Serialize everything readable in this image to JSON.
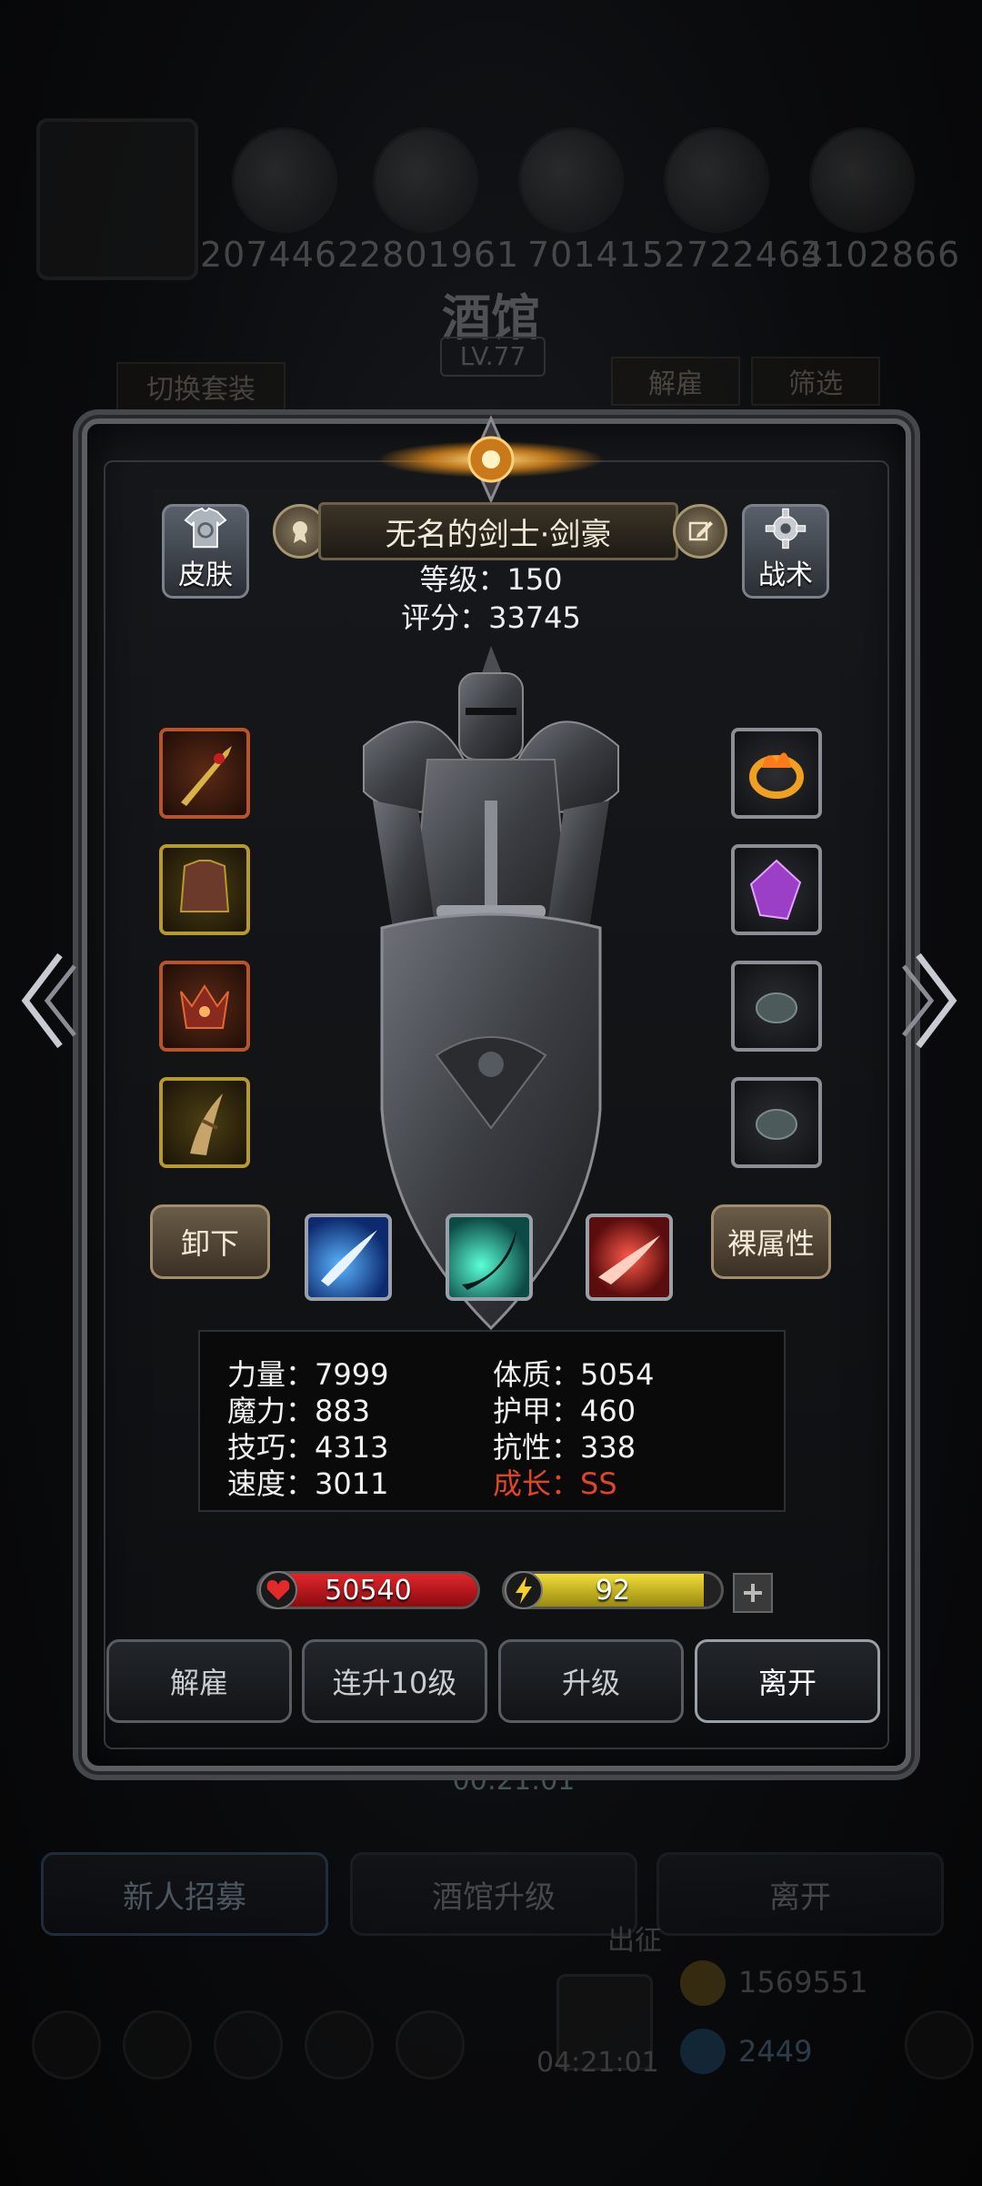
{
  "background": {
    "resources": [
      "2074462",
      "2801961",
      "701415",
      "2722464",
      "3102866"
    ],
    "tavern_title": "酒馆",
    "tavern_level": "LV.77",
    "switch_outfit": "切换套装",
    "dismiss": "解雇",
    "filter": "筛选",
    "timer_mid": "00:21:01",
    "bottom_buttons": [
      "新人招募",
      "酒馆升级",
      "离开"
    ],
    "expedition": "出征",
    "gold": "1569551",
    "gems": "2449",
    "timer_bottom": "04:21:01"
  },
  "hero": {
    "name": "无名的剑士·剑豪",
    "level_text": "等级：150",
    "score_text": "评分：33745",
    "skin_label": "皮肤",
    "tactics_label": "战术",
    "unequip_label": "卸下",
    "base_attr_label": "裸属性"
  },
  "stats": {
    "strength": "力量：7999",
    "constitution": "体质：5054",
    "magic": "魔力：883",
    "armor": "护甲：460",
    "skill": "技巧：4313",
    "resistance": "抗性：338",
    "speed": "速度：3011",
    "growth": "成长：SS"
  },
  "bars": {
    "hp": "50540",
    "energy": "92",
    "energy_fraction": 0.92
  },
  "actions": [
    "解雇",
    "连升10级",
    "升级",
    "离开"
  ],
  "colors": {
    "hp": "#c8161c",
    "energy": "#d8c21a",
    "growth": "#e0452a",
    "frame": "#5b5d61"
  },
  "icons": {
    "left_slots": [
      "sword-icon",
      "chest-armor-icon",
      "demon-helm-icon",
      "claw-icon"
    ],
    "right_slots": [
      "flame-ring-icon",
      "purple-crystal-icon",
      "stone-icon",
      "stone-icon"
    ],
    "skills": [
      "slash-blue-icon",
      "slash-cyan-icon",
      "slash-red-icon"
    ]
  }
}
